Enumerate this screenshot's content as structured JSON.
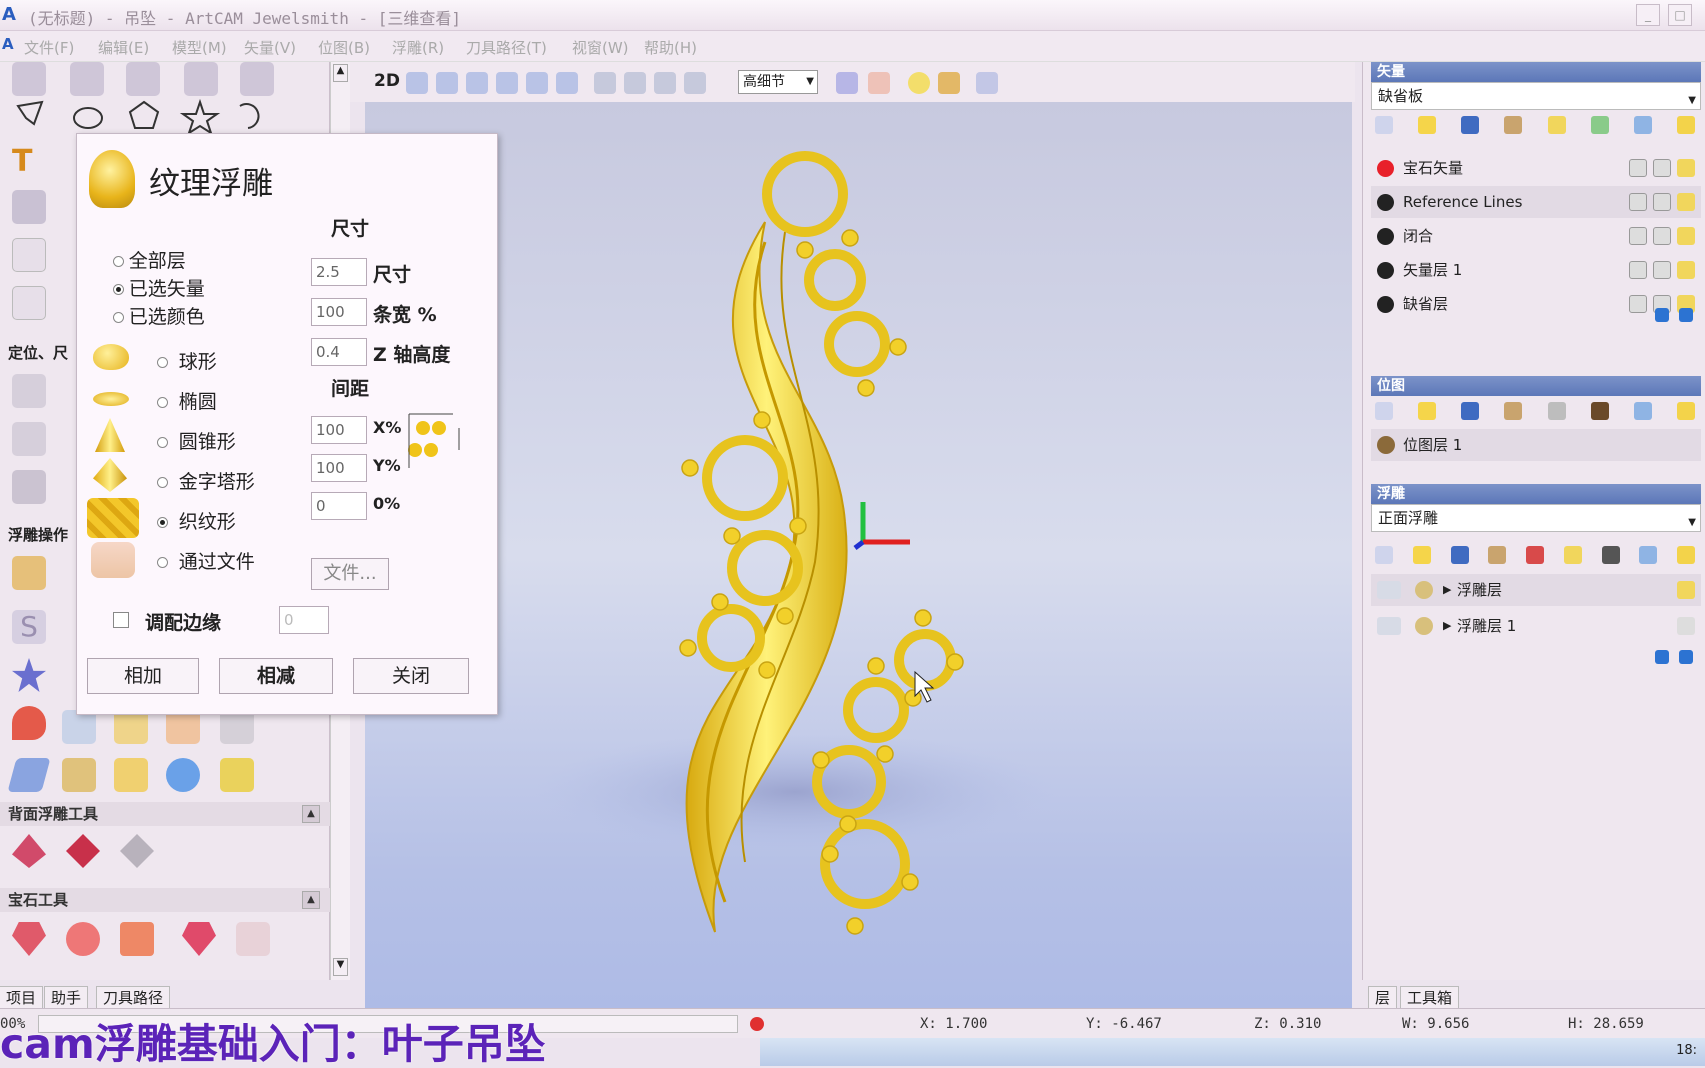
{
  "window": {
    "title": "(无标题) - 吊坠 - ArtCAM Jewelsmith - [三维查看]",
    "logo": "A",
    "min": "_",
    "max": "□"
  },
  "menu": [
    "文件(F)",
    "编辑(E)",
    "模型(M)",
    "矢量(V)",
    "位图(B)",
    "浮雕(R)",
    "刀具路径(T)",
    "视窗(W)",
    "帮助(H)"
  ],
  "view_toolbar": {
    "mode_2d": "2D",
    "detail_select": "高细节"
  },
  "left_toolbar": {
    "section_position": "定位、尺",
    "section_relief_ops": "浮雕操作",
    "section_back_relief": "背面浮雕工具",
    "section_gem": "宝石工具",
    "tabs": [
      "项目",
      "助手",
      "刀具路径"
    ]
  },
  "dialog": {
    "title": "纹理浮雕",
    "size_heading": "尺寸",
    "scope_options": [
      "全部层",
      "已选矢量",
      "已选颜色"
    ],
    "scope_selected": "已选矢量",
    "size_value": "2.5",
    "size_label": "尺寸",
    "strip_value": "100",
    "strip_label": "条宽 %",
    "z_value": "0.4",
    "z_label": "Z 轴高度",
    "spacing_heading": "间距",
    "x_value": "100",
    "x_label": "X%",
    "y_value": "100",
    "y_label": "Y%",
    "o_value": "0",
    "o_label": "0%",
    "shapes": [
      "球形",
      "椭圆",
      "圆锥形",
      "金字塔形",
      "织纹形",
      "通过文件"
    ],
    "shape_selected": "织纹形",
    "file_button": "文件...",
    "fit_edge": "调配边缘",
    "fit_value": "0",
    "add_button": "相加",
    "subtract_button": "相减",
    "close_button": "关闭",
    "colors": {
      "gold": "#f0c419"
    }
  },
  "right_panel": {
    "vector_header": "矢量",
    "vector_sheet": "缺省板",
    "vector_layers": [
      {
        "name": "宝石矢量",
        "color": "#e8202a"
      },
      {
        "name": "Reference Lines",
        "color": "#222222"
      },
      {
        "name": "闭合",
        "color": "#222222"
      },
      {
        "name": "矢量层 1",
        "color": "#222222"
      },
      {
        "name": "缺省层",
        "color": "#222222"
      }
    ],
    "bitmap_header": "位图",
    "bitmap_layers": [
      "位图层 1"
    ],
    "relief_header": "浮雕",
    "relief_sheet": "正面浮雕",
    "relief_layers": [
      "浮雕层",
      "浮雕层 1"
    ],
    "tabs": [
      "层",
      "工具箱"
    ]
  },
  "status": {
    "progress": "00%",
    "x": "X: 1.700",
    "y": "Y: -6.467",
    "z": "Z: 0.310",
    "w": "W: 9.656",
    "h": "H: 28.659"
  },
  "caption": "cam浮雕基础入门：叶子吊坠",
  "taskbar_time": "18:"
}
